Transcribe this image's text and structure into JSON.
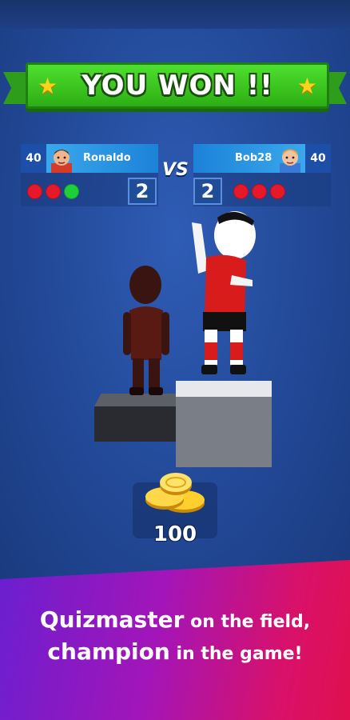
{
  "banner": {
    "title": "YOU WON !!"
  },
  "players": {
    "left": {
      "level": "40",
      "name": "Ronaldo",
      "score": "2",
      "answers": [
        "#e8182b",
        "#e8182b",
        "#1fcf3a"
      ]
    },
    "right": {
      "level": "40",
      "name": "Bob28",
      "score": "2",
      "answers": [
        "#e8182b",
        "#e8182b",
        "#e8182b"
      ]
    },
    "vs_label": "VS"
  },
  "reward": {
    "coins": "100"
  },
  "promo": {
    "line1_bold": "Quizmaster",
    "line1_rest": " on the field,",
    "line2_bold": "champion",
    "line2_rest": " in the game!"
  },
  "colors": {
    "correct": "#1fcf3a",
    "wrong": "#e8182b",
    "banner": "#3ccb22"
  },
  "icons": [
    "star-icon",
    "coin-stack-icon",
    "avatar-icon"
  ]
}
